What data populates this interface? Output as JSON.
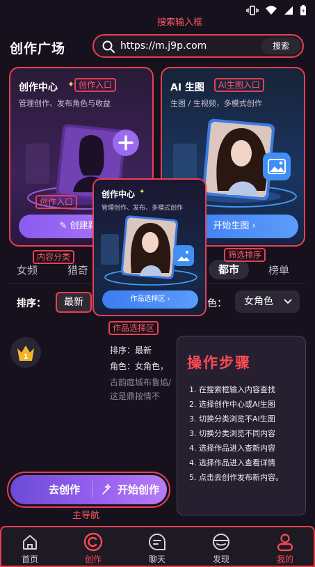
{
  "header": {
    "title": "创作广场"
  },
  "search": {
    "value": "https://m.j9p.com",
    "button": "搜索"
  },
  "annotations": {
    "search": "搜索输入框",
    "create_entry": "创作入口",
    "create_entry_2": "创作入口",
    "ai_entry": "AI生图入口",
    "category": "内容分类",
    "filter_sort": "筛选排序",
    "works_select": "作品选择区",
    "main_nav": "主导航"
  },
  "card_create": {
    "title": "创作中心",
    "desc": "管理创作、发布角色与收益",
    "button": "创建新角"
  },
  "card_ai": {
    "title": "AI 生图",
    "desc": "生图 / 生视频，多模式创作",
    "button": "开始生图 ›"
  },
  "popup": {
    "title": "创作中心",
    "desc": "管理创作、发布、多模式创作",
    "button": "作品选择区 ›"
  },
  "tabs": [
    "女频",
    "猎奇",
    "都市",
    "榜单"
  ],
  "sort": {
    "label": "排序：",
    "value": "最新"
  },
  "role": {
    "label": "色：",
    "value": "女角色"
  },
  "rank_badge": "1",
  "info": {
    "line1": "排序：最新",
    "line2": "角色：女角色，",
    "line3": "古韵庭城布鲁焰/",
    "line4": "这是鼎按情不"
  },
  "steps": {
    "title": "操作步骤",
    "items": [
      "1. 在搜索框输入内容查找",
      "2. 选择创作中心或AI生图",
      "3. 切换分类浏览不AI生图",
      "3. 切换分类浏览不同内容",
      "4. 选择作品进入查新内容",
      "4. 选择作品进入查看详情",
      "5. 点击去创作发布新内容。"
    ]
  },
  "action": {
    "left": "去创作",
    "right": "开始创作"
  },
  "nav": [
    {
      "label": "首页",
      "icon": "home-icon"
    },
    {
      "label": "创作",
      "icon": "create-icon"
    },
    {
      "label": "聊天",
      "icon": "chat-icon"
    },
    {
      "label": "发现",
      "icon": "discover-icon"
    },
    {
      "label": "我的",
      "icon": "profile-icon"
    }
  ],
  "colors": {
    "accent": "#e8404f",
    "purple": "#8a5bf0",
    "blue": "#3c7bf2",
    "bg": "#17111e"
  }
}
